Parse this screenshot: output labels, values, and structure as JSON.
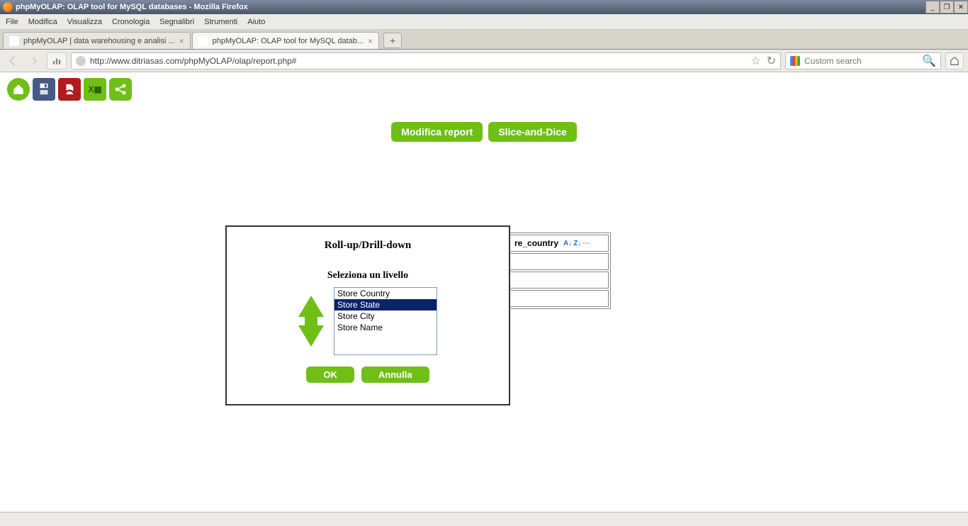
{
  "window": {
    "title": "phpMyOLAP: OLAP tool for MySQL databases - Mozilla Firefox"
  },
  "menubar": [
    "File",
    "Modifica",
    "Visualizza",
    "Cronologia",
    "Segnalibri",
    "Strumenti",
    "Aiuto"
  ],
  "tabs": [
    {
      "label": "phpMyOLAP | data warehousing e analisi ...",
      "active": false
    },
    {
      "label": "phpMyOLAP: OLAP tool for MySQL datab...",
      "active": true
    }
  ],
  "url": "http://www.ditriasas.com/phpMyOLAP/olap/report.php#",
  "searchbox_placeholder": "Custom search",
  "page": {
    "green_buttons": {
      "modify": "Modifica report",
      "slice": "Slice-and-Dice"
    },
    "data_header": "re_country",
    "dialog": {
      "title": "Roll-up/Drill-down",
      "subtitle": "Seleziona un livello",
      "levels": [
        "Store Country",
        "Store State",
        "Store City",
        "Store Name"
      ],
      "selected_index": 1,
      "ok": "OK",
      "cancel": "Annulla"
    }
  }
}
